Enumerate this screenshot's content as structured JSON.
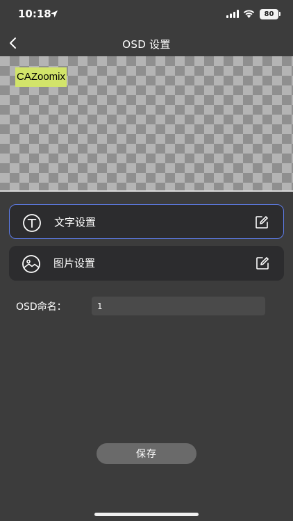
{
  "status_bar": {
    "time": "10:18",
    "battery": "80"
  },
  "nav": {
    "title": "OSD 设置"
  },
  "preview": {
    "osd_text": "CAZoomix"
  },
  "settings": [
    {
      "label": "文字设置",
      "icon": "text-t-icon",
      "active": true
    },
    {
      "label": "图片设置",
      "icon": "image-icon",
      "active": false
    }
  ],
  "name_field": {
    "label": "OSD命名：",
    "value": "1"
  },
  "save_button": {
    "label": "保存"
  },
  "colors": {
    "background": "#3c3c3c",
    "card": "#2c2c2e",
    "active_border": "#5d7be6",
    "osd_highlight": "#d2e46a",
    "button": "#6a6a6a"
  }
}
